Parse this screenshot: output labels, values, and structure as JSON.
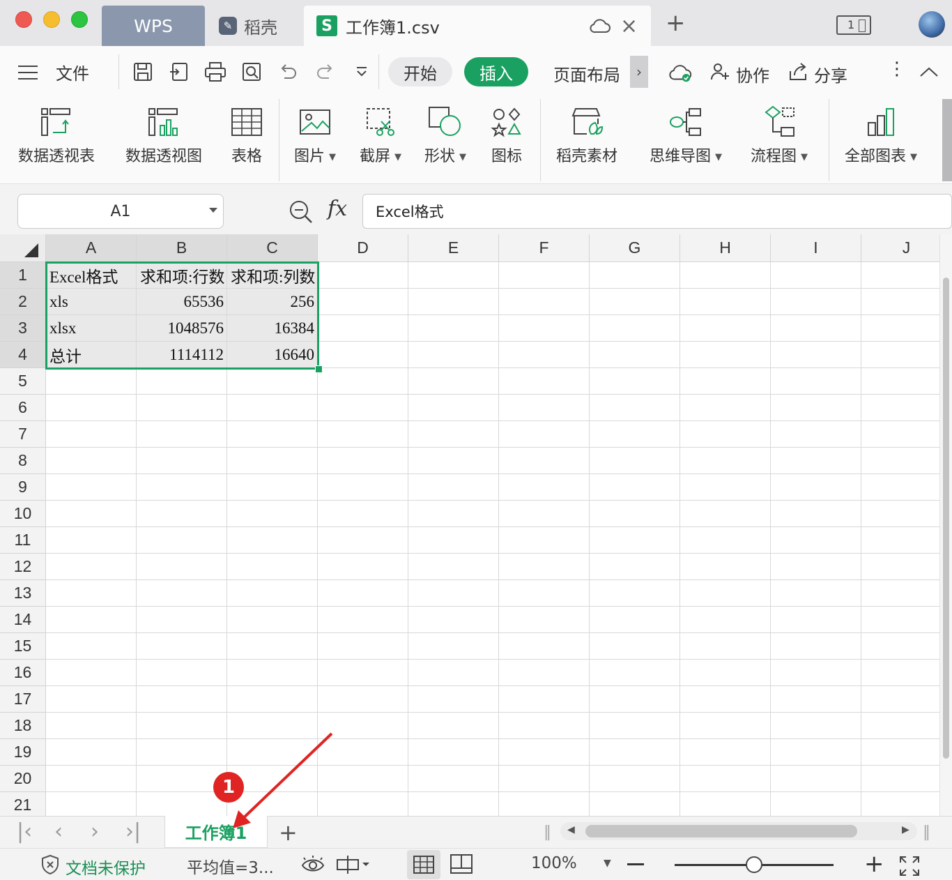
{
  "titlebar": {
    "tabs": {
      "wps": "WPS",
      "daoke": "稻壳",
      "document": "工作簿1.csv"
    },
    "window_count": "1"
  },
  "menubar": {
    "file": "文件",
    "tabs": {
      "start": "开始",
      "insert": "插入",
      "page_layout": "页面布局"
    },
    "collaborate": "协作",
    "share": "分享"
  },
  "ribbon": {
    "pivot_table": "数据透视表",
    "pivot_chart": "数据透视图",
    "table": "表格",
    "picture": "图片",
    "screenshot": "截屏",
    "shape": "形状",
    "icon": "图标",
    "daoke_material": "稻壳素材",
    "mind_map": "思维导图",
    "flowchart": "流程图",
    "all_charts": "全部图表"
  },
  "formula_bar": {
    "name_box": "A1",
    "fx_label": "fx",
    "content": "Excel格式"
  },
  "sheet": {
    "columns": [
      "A",
      "B",
      "C",
      "D",
      "E",
      "F",
      "G",
      "H",
      "I",
      "J"
    ],
    "rows": [
      "1",
      "2",
      "3",
      "4",
      "5",
      "6",
      "7",
      "8",
      "9",
      "10",
      "11",
      "12",
      "13",
      "14",
      "15",
      "16",
      "17",
      "18",
      "19",
      "20",
      "21"
    ],
    "cells": {
      "A1": "Excel格式",
      "B1": "求和项:行数",
      "C1": "求和项:列数",
      "A2": "xls",
      "B2": "65536",
      "C2": "256",
      "A3": "xlsx",
      "B3": "1048576",
      "C3": "16384",
      "A4": "总计",
      "B4": "1114112",
      "C4": "16640"
    }
  },
  "sheet_tabs": {
    "active": "工作簿1"
  },
  "statusbar": {
    "protection": "文档未保护",
    "average": "平均值=3...",
    "zoom": "100%"
  },
  "annotation": {
    "badge": "1"
  },
  "colors": {
    "accent": "#1aa161",
    "annotation": "#e02424"
  }
}
